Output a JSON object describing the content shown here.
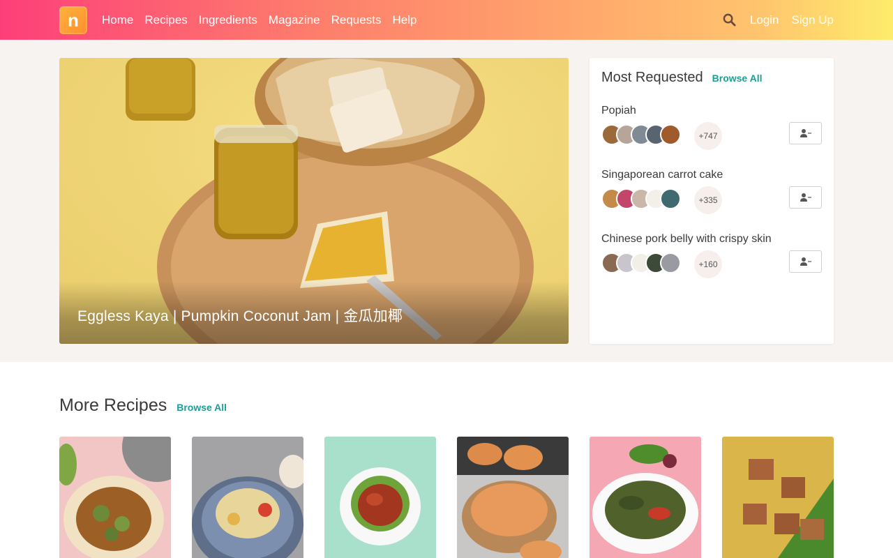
{
  "nav": {
    "logo_letter": "n",
    "items": [
      "Home",
      "Recipes",
      "Ingredients",
      "Magazine",
      "Requests",
      "Help"
    ],
    "login": "Login",
    "signup": "Sign Up",
    "search_icon": "search-icon"
  },
  "hero": {
    "title": "Eggless Kaya | Pumpkin Coconut Jam | 金瓜加椰"
  },
  "requested": {
    "title": "Most Requested",
    "browse_all": "Browse All",
    "items": [
      {
        "name": "Popiah",
        "count": "+747"
      },
      {
        "name": "Singaporean carrot cake",
        "count": "+335"
      },
      {
        "name": "Chinese pork belly with crispy skin",
        "count": "+160"
      }
    ]
  },
  "more_recipes": {
    "title": "More Recipes",
    "browse_all": "Browse All"
  },
  "colors": {
    "accent": "#1a9e95",
    "header_start": "#fd3f79",
    "header_end": "#fdec6b"
  }
}
